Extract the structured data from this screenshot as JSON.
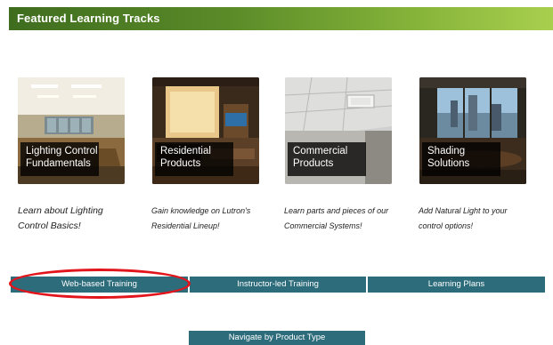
{
  "header": {
    "title": "Featured Learning Tracks"
  },
  "tracks": [
    {
      "caption_line1": "Lighting Control",
      "caption_line2": "Fundamentals",
      "desc_line1": "Learn about Lighting",
      "desc_line2": "Control Basics!",
      "image": "office-conference-room-photo"
    },
    {
      "caption_line1": "Residential",
      "caption_line2": "Products",
      "desc_line1": "Gain knowledge on Lutron's",
      "desc_line2": "Residential Lineup!",
      "image": "living-room-photo"
    },
    {
      "caption_line1": "Commercial",
      "caption_line2": "Products",
      "desc_line1": "Learn parts and pieces of our",
      "desc_line2": "Commercial Systems!",
      "image": "ceiling-fixture-photo"
    },
    {
      "caption_line1": "Shading",
      "caption_line2": "Solutions",
      "desc_line1": "Add Natural Light to your",
      "desc_line2": "control options!",
      "image": "boardroom-windows-photo"
    }
  ],
  "tabs": {
    "web": "Web-based Training",
    "instructor": "Instructor-led Training",
    "plans": "Learning Plans"
  },
  "navigate": "Navigate by Product Type",
  "colors": {
    "header_start": "#3f6d1f",
    "header_end": "#a9cf4e",
    "button": "#2d6c7b",
    "highlight": "#e3151c"
  }
}
